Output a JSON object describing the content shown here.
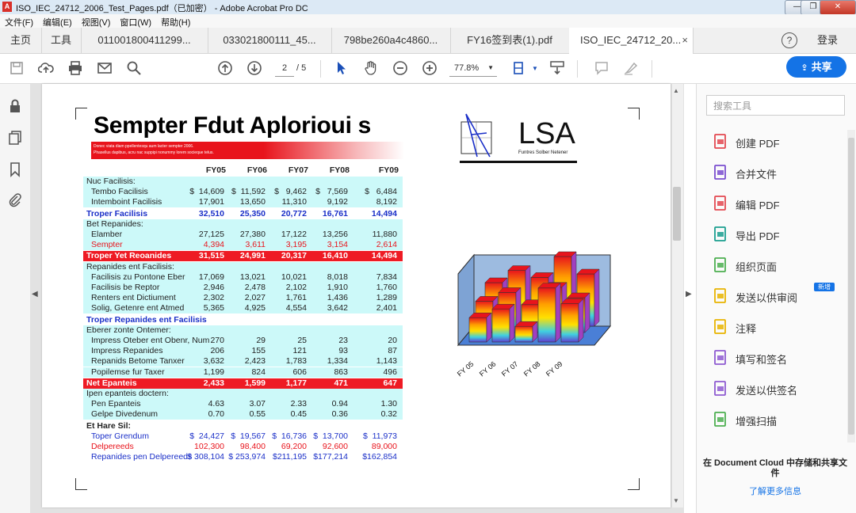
{
  "window": {
    "title": "ISO_IEC_24712_2006_Test_Pages.pdf（已加密） - Adobe Acrobat Pro DC",
    "minimize": "—",
    "maximize": "❐",
    "close": "✕"
  },
  "menu": [
    "文件(F)",
    "编辑(E)",
    "视图(V)",
    "窗口(W)",
    "帮助(H)"
  ],
  "tabs": [
    {
      "label": "主页"
    },
    {
      "label": "工具"
    },
    {
      "label": "011001800411299..."
    },
    {
      "label": "033021800111_45..."
    },
    {
      "label": "798be260a4c4860..."
    },
    {
      "label": "FY16签到表(1).pdf"
    },
    {
      "label": "ISO_IEC_24712_20...",
      "close": "×"
    }
  ],
  "header_right": {
    "help": "?",
    "login": "登录"
  },
  "toolbar": {
    "page_current": "2",
    "page_total": "/ 5",
    "zoom": "77.8%",
    "share": "共享"
  },
  "tools_pane": {
    "search_placeholder": "搜索工具",
    "items": [
      {
        "label": "创建 PDF",
        "icon": "create-pdf-icon",
        "color": "#e34850"
      },
      {
        "label": "合并文件",
        "icon": "combine-files-icon",
        "color": "#7a4ecf"
      },
      {
        "label": "编辑 PDF",
        "icon": "edit-pdf-icon",
        "color": "#e34850"
      },
      {
        "label": "导出 PDF",
        "icon": "export-pdf-icon",
        "color": "#1a9e8f"
      },
      {
        "label": "组织页面",
        "icon": "organize-pages-icon",
        "color": "#4caf50"
      },
      {
        "label": "发送以供审阅",
        "icon": "send-review-icon",
        "color": "#e8b400"
      },
      {
        "label": "注释",
        "icon": "comment-icon",
        "color": "#e8b400"
      },
      {
        "label": "填写和签名",
        "icon": "fill-sign-icon",
        "color": "#8e5bd1"
      },
      {
        "label": "发送以供签名",
        "icon": "send-sign-icon",
        "color": "#8e5bd1"
      },
      {
        "label": "增强扫描",
        "icon": "enhance-scan-icon",
        "color": "#4caf50"
      }
    ],
    "new_badge": "新增",
    "cloud_text": "在 Document Cloud 中存储和共享文件",
    "learn_more": "了解更多信息"
  },
  "document": {
    "title": "Sempter Fdut Aplorioui s",
    "band_line1": "Donec viata diam ppellentesqu aum lacter sempter 2006.",
    "band_line2": "Phasellus dapibus, acru nac suppipi nonummy lorem socieque telus.",
    "logo_text": "LSA",
    "logo_sub": "Funtres Solber Netener",
    "columns": [
      "FY05",
      "FY06",
      "FY07",
      "FY08",
      "FY09"
    ],
    "rows": [
      {
        "label": "Nuc Facilisis:",
        "style": "cy",
        "v": []
      },
      {
        "label": "Tembo Facilisis",
        "style": "cy",
        "indent": true,
        "v": [
          "$  14,609",
          "$  11,592",
          "$   9,462",
          "$   7,569",
          "$   6,484"
        ]
      },
      {
        "label": "Intemboint Facilisis",
        "style": "cy",
        "indent": true,
        "v": [
          "17,901",
          "13,650",
          "11,310",
          "9,192",
          "8,192"
        ]
      },
      {
        "label": "Troper Facilisis",
        "style": "bl",
        "v": [
          "32,510",
          "25,350",
          "20,772",
          "16,761",
          "14,494"
        ]
      },
      {
        "label": "Bet Repanides:",
        "style": "cy",
        "v": []
      },
      {
        "label": "Elamber",
        "style": "cy",
        "indent": true,
        "v": [
          "27,125",
          "27,380",
          "17,122",
          "13,256",
          "11,880"
        ]
      },
      {
        "label": "Sempter",
        "style": "cyr",
        "indent": true,
        "v": [
          "4,394",
          "3,611",
          "3,195",
          "3,154",
          "2,614"
        ]
      },
      {
        "label": "Troper Yet Reoanides",
        "style": "rd",
        "v": [
          "31,515",
          "24,991",
          "20,317",
          "16,410",
          "14,494"
        ]
      },
      {
        "label": "Repanides ent Facilisis:",
        "style": "cy",
        "v": []
      },
      {
        "label": "Facilisis zu Pontone Eber",
        "style": "cy",
        "indent": true,
        "v": [
          "17,069",
          "13,021",
          "10,021",
          "8,018",
          "7,834"
        ]
      },
      {
        "label": "Facilisis be Reptor",
        "style": "cy",
        "indent": true,
        "v": [
          "2,946",
          "2,478",
          "2,102",
          "1,910",
          "1,760"
        ]
      },
      {
        "label": "Renters ent Dictiument",
        "style": "cy",
        "indent": true,
        "v": [
          "2,302",
          "2,027",
          "1,761",
          "1,436",
          "1,289"
        ]
      },
      {
        "label": "Solig, Getenre ent Atmed",
        "style": "cy",
        "indent": true,
        "v": [
          "5,365",
          "4,925",
          "4,554",
          "3,642",
          "2,401"
        ]
      },
      {
        "label": "Troper Repanides ent Facilisis",
        "style": "bl",
        "v": []
      },
      {
        "label": "Eberer zonte Ontemer:",
        "style": "cy",
        "v": []
      },
      {
        "label": "Impress Oteber ent Obenr, Num",
        "style": "cy",
        "indent": true,
        "v": [
          "270",
          "29",
          "25",
          "23",
          "20"
        ]
      },
      {
        "label": "Impress Repanides",
        "style": "cy",
        "indent": true,
        "v": [
          "206",
          "155",
          "121",
          "93",
          "87"
        ]
      },
      {
        "label": "Repanids Betome Tanxer",
        "style": "cy",
        "indent": true,
        "v": [
          "3,632",
          "2,423",
          "1,783",
          "1,334",
          "1,143"
        ]
      },
      {
        "label": "Popilemse fur Taxer",
        "style": "cy",
        "indent": true,
        "v": [
          "1,199",
          "824",
          "606",
          "863",
          "496"
        ]
      },
      {
        "label": "Net Epanteis",
        "style": "rd",
        "v": [
          "2,433",
          "1,599",
          "1,177",
          "471",
          "647"
        ]
      },
      {
        "label": "Ipen epanteis doctern:",
        "style": "cy",
        "v": []
      },
      {
        "label": "Pen Epanteis",
        "style": "cy",
        "indent": true,
        "v": [
          "4.63",
          "3.07",
          "2.33",
          "0.94",
          "1.30"
        ]
      },
      {
        "label": "Gelpe Divedenum",
        "style": "cy",
        "indent": true,
        "v": [
          "0.70",
          "0.55",
          "0.45",
          "0.36",
          "0.32"
        ]
      },
      {
        "label": "Et Hare Sil:",
        "style": "wb",
        "v": []
      },
      {
        "label": "Toper Grendum",
        "style": "blu",
        "indent": true,
        "v": [
          "$  24,427",
          "$  19,567",
          "$  16,736",
          "$  13,700",
          "$  11,973"
        ]
      },
      {
        "label": "Delpereeds",
        "style": "red",
        "indent": true,
        "v": [
          "102,300",
          "98,400",
          "69,200",
          "92,600",
          "89,000"
        ]
      },
      {
        "label": "Repanides pen Delpereeds",
        "style": "blu",
        "indent": true,
        "v": [
          "$ 308,104",
          "$ 253,974",
          "$211,195",
          "$177,214",
          "$162,854"
        ]
      }
    ],
    "chart_labels": [
      "FY 05",
      "FY 06",
      "FY 07",
      "FY 08",
      "FY 09"
    ],
    "chart": {
      "back": [
        2.5,
        3.2,
        2.8,
        4.0,
        3.0
      ],
      "mid": [
        1.8,
        2.3,
        1.6,
        2.6,
        2.0
      ],
      "front": [
        1.4,
        1.9,
        0.9,
        3.1,
        2.2
      ]
    }
  }
}
